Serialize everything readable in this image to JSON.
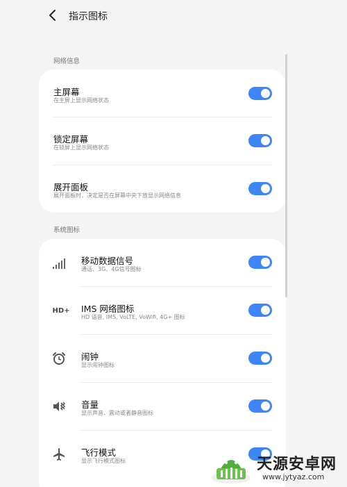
{
  "header": {
    "title": "指示图标"
  },
  "sections": {
    "network": {
      "label": "网络信息",
      "items": [
        {
          "title": "主屏幕",
          "subtitle": "在主屏上显示网络状态",
          "enabled": true
        },
        {
          "title": "锁定屏幕",
          "subtitle": "在锁屏上显示网络状态",
          "enabled": true
        },
        {
          "title": "展开面板",
          "subtitle": "展开面板时，决定是否在屏幕中央下放显示网络信息",
          "enabled": true
        }
      ]
    },
    "system": {
      "label": "系统图标",
      "items": [
        {
          "title": "移动数据信号",
          "subtitle": "通话、3G、4G信号图标",
          "icon": "signal-bars-icon",
          "enabled": true
        },
        {
          "title": "IMS 网络图标",
          "subtitle": "HD 语音, IMS, VoLTE, VoWifi, 4G+ 图标",
          "icon": "hd-plus-icon",
          "icon_text": "HD+",
          "enabled": true
        },
        {
          "title": "闹钟",
          "subtitle": "显示闹钟图标",
          "icon": "alarm-clock-icon",
          "enabled": true
        },
        {
          "title": "音量",
          "subtitle": "显示声音、震动或者静音图标",
          "icon": "volume-vibrate-icon",
          "enabled": true
        },
        {
          "title": "飞行模式",
          "subtitle": "显示飞行模式图标",
          "icon": "airplane-icon",
          "enabled": true
        }
      ]
    }
  },
  "colors": {
    "accent": "#3e86f5",
    "background": "#f4f4f4",
    "card": "#ffffff"
  },
  "watermark": {
    "title": "天源安卓网",
    "url": "www.jytyaz.com"
  }
}
